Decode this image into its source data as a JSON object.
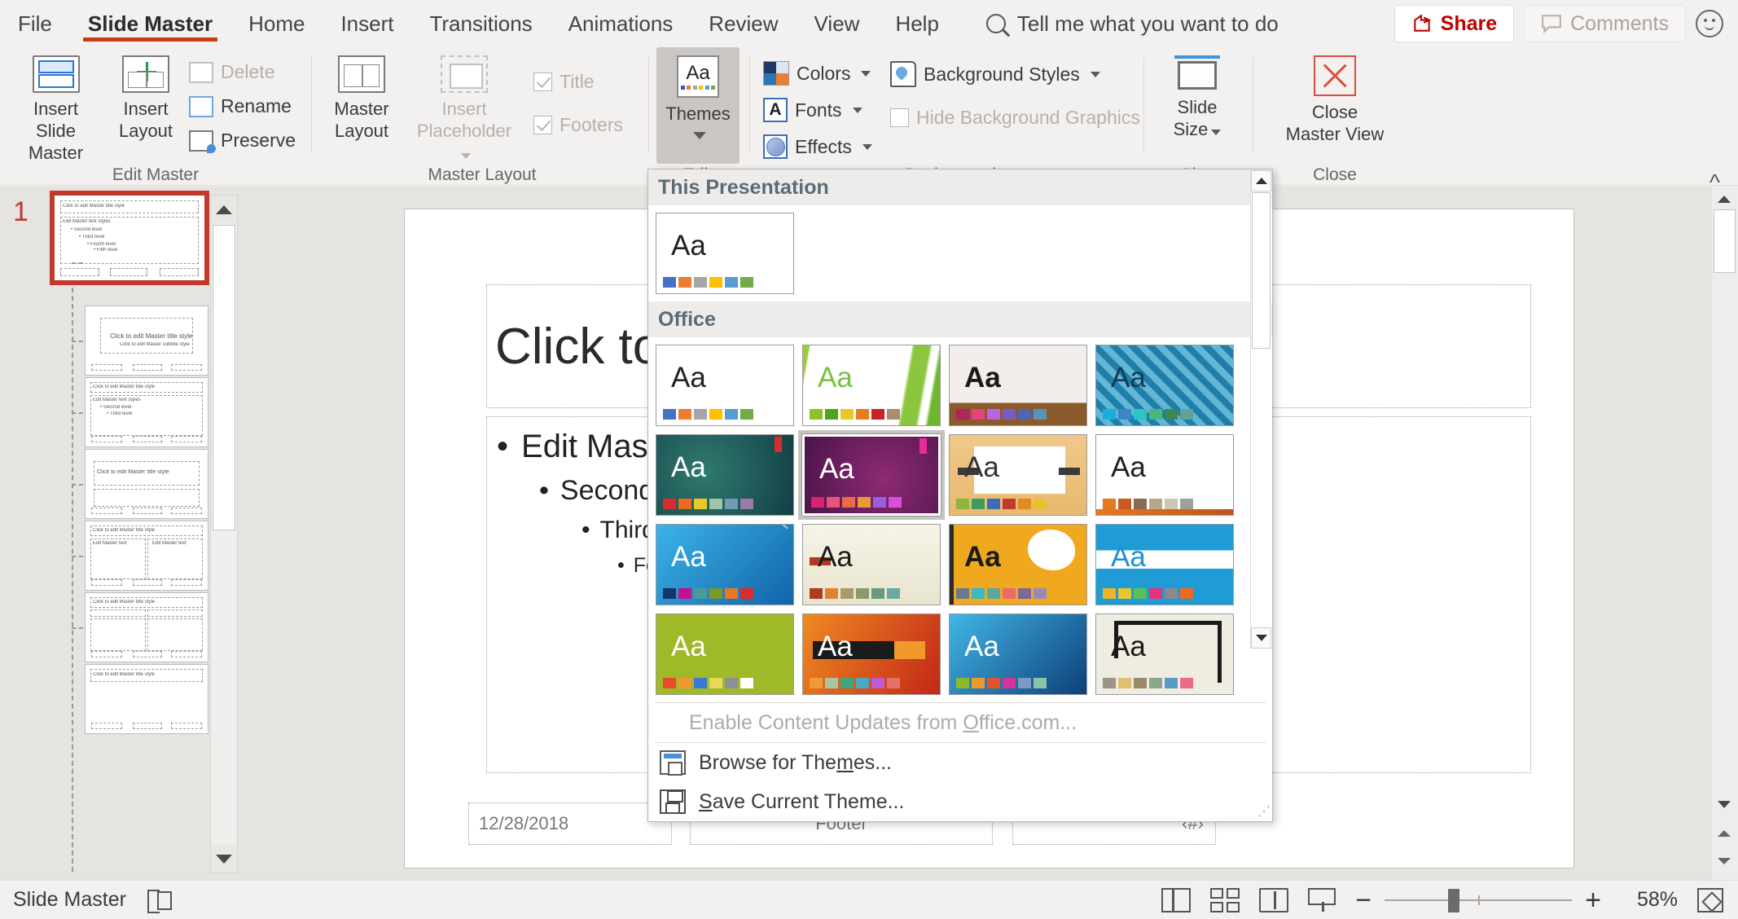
{
  "tabs": [
    {
      "label": "File",
      "active": false
    },
    {
      "label": "Slide Master",
      "active": true
    },
    {
      "label": "Home",
      "active": false
    },
    {
      "label": "Insert",
      "active": false
    },
    {
      "label": "Transitions",
      "active": false
    },
    {
      "label": "Animations",
      "active": false
    },
    {
      "label": "Review",
      "active": false
    },
    {
      "label": "View",
      "active": false
    },
    {
      "label": "Help",
      "active": false
    }
  ],
  "search": {
    "placeholder": "Tell me what you want to do",
    "icon": "search-icon"
  },
  "titlebar": {
    "share": "Share",
    "comments": "Comments",
    "smiley_icon": "smiley-face-icon"
  },
  "ribbon": {
    "groups": [
      {
        "label": "Edit Master"
      },
      {
        "label": "Master Layout"
      },
      {
        "label": "Edit Theme"
      },
      {
        "label": "Background"
      },
      {
        "label": "Size"
      },
      {
        "label": "Close"
      }
    ],
    "insert_slide_master": "Insert Slide\nMaster",
    "insert_slide_master_l1": "Insert Slide",
    "insert_slide_master_l2": "Master",
    "insert_layout_l1": "Insert",
    "insert_layout_l2": "Layout",
    "delete": "Delete",
    "rename": "Rename",
    "preserve": "Preserve",
    "master_layout_l1": "Master",
    "master_layout_l2": "Layout",
    "insert_placeholder_l1": "Insert",
    "insert_placeholder_l2": "Placeholder",
    "title_check": "Title",
    "footers_check": "Footers",
    "themes": "Themes",
    "colors": "Colors",
    "fonts": "Fonts",
    "effects": "Effects",
    "background_styles": "Background Styles",
    "hide_background_graphics": "Hide Background Graphics",
    "slide_size_l1": "Slide",
    "slide_size_l2": "Size",
    "close_master_l1": "Close",
    "close_master_l2": "Master View",
    "collapse_icon": "chevron-up-icon"
  },
  "slide_panel": {
    "slide_number": "1",
    "thumbs": [
      {
        "title": "Click to edit Master title style",
        "kind": "master"
      },
      {
        "title": "Click to edit Master title style",
        "kind": "title"
      },
      {
        "title": "Click to edit Master title style",
        "kind": "content"
      },
      {
        "title": "Click to edit Master title style",
        "kind": "section"
      },
      {
        "title": "Click to edit Master title style",
        "kind": "two-content"
      },
      {
        "title": "Click to edit Master title style",
        "kind": "comparison"
      },
      {
        "title": "Click to edit Master title style",
        "kind": "title-only"
      }
    ]
  },
  "slide": {
    "title_placeholder": "Click to edit Master title style",
    "bullets": [
      "Edit Master text styles",
      "Second level",
      "Third level",
      "Fourth level"
    ],
    "footer_date": "12/28/2018",
    "footer_text": "Footer",
    "footer_number": "‹#›"
  },
  "themes_dropdown": {
    "section_this_presentation": "This Presentation",
    "section_office": "Office",
    "enable_updates": "Enable Content Updates from Office.com...",
    "browse_for_themes": "Browse for Themes...",
    "save_current_theme": "Save Current Theme...",
    "scroll_up_icon": "triangle-up-icon",
    "scroll_down_icon": "triangle-down-icon",
    "aa_label": "Aa",
    "this_presentation_themes": [
      {
        "name": "office-theme",
        "aa_color": "#222222",
        "bg": "#ffffff",
        "swatches": [
          "#4472c4",
          "#ed7d31",
          "#a5a5a5",
          "#ffc000",
          "#5b9bd5",
          "#70ad47"
        ],
        "selected": false
      }
    ],
    "office_themes": [
      {
        "name": "office",
        "aa_color": "#222222",
        "bg": "#ffffff",
        "swatches": [
          "#4472c4",
          "#ed7d31",
          "#a5a5a5",
          "#ffc000",
          "#5b9bd5",
          "#70ad47"
        ],
        "selected": false
      },
      {
        "name": "facet",
        "aa_color": "#7ac143",
        "bg": "#ffffff",
        "swatches": [
          "#90c226",
          "#54a021",
          "#e8c72a",
          "#e87d1e",
          "#cb2128",
          "#a88d6a"
        ],
        "selected": false
      },
      {
        "name": "gallery",
        "aa_color": "#1a1a1a",
        "bg": "#efe9e6",
        "swatches": [
          "#b4245c",
          "#e8427f",
          "#b965e0",
          "#7a5bbf",
          "#4d66b5",
          "#5b93b8"
        ],
        "selected": false
      },
      {
        "name": "ion",
        "aa_color": "#103a52",
        "bg": "#1f7fa8",
        "swatches": [
          "#1caedb",
          "#3a86c8",
          "#2fc4c4",
          "#49b87a",
          "#3a8a4f",
          "#62a09a"
        ],
        "selected": false
      },
      {
        "name": "ion-boardroom",
        "aa_color": "#ffffff",
        "bg": "#215a5a",
        "swatches": [
          "#d92b2b",
          "#ea6a1f",
          "#e8c72a",
          "#9fc4a8",
          "#6f9bb5",
          "#9a7ba8"
        ],
        "selected": false
      },
      {
        "name": "badge",
        "aa_color": "#ffffff",
        "bg": "#6b2060",
        "swatches": [
          "#d6246e",
          "#e8537a",
          "#ea6a4a",
          "#eb9a36",
          "#9a5ce0",
          "#d94fd9"
        ],
        "selected": true
      },
      {
        "name": "berlin",
        "aa_color": "#333333",
        "bg": "#f0c88a",
        "swatches": [
          "#8cb63c",
          "#3c9e5e",
          "#3a6db5",
          "#c23a2b",
          "#e08a22",
          "#e8c22a"
        ],
        "selected": false
      },
      {
        "name": "celestial",
        "aa_color": "#222222",
        "bg": "#ffffff",
        "swatches": [
          "#e87722",
          "#c85a22",
          "#8a6a52",
          "#b5a88a",
          "#cdc6b0",
          "#9aa39a"
        ],
        "selected": false
      },
      {
        "name": "circuit",
        "aa_color": "#ffffff",
        "bg": "#1f9bd6",
        "swatches": [
          "#10366b",
          "#c2118a",
          "#4a9a9a",
          "#7a9a2a",
          "#e87722",
          "#d92b2b"
        ],
        "selected": false
      },
      {
        "name": "damask",
        "aa_color": "#1a1a1a",
        "bg": "#f2f1e4",
        "swatches": [
          "#b03a20",
          "#e08030",
          "#a89a6a",
          "#8a9a6a",
          "#6a9a7a",
          "#6aa8a0"
        ],
        "selected": false
      },
      {
        "name": "depth",
        "aa_color": "#1a1a1a",
        "bg": "#f0a81e",
        "swatches": [
          "#6a7a8a",
          "#3ab8c4",
          "#5aa8a0",
          "#e86a6a",
          "#7a6a9a",
          "#9a8ab5"
        ],
        "selected": false
      },
      {
        "name": "dividend",
        "aa_color": "#1f8fd6",
        "bg": "#1f9bd6",
        "swatches": [
          "#f0b323",
          "#e8c72a",
          "#5abf5a",
          "#e8327a",
          "#8a8a8a",
          "#ee6a1e"
        ],
        "selected": false
      },
      {
        "name": "droplet",
        "aa_color": "#ffffff",
        "bg": "#9fba28",
        "swatches": [
          "#e84a2a",
          "#ef9a2a",
          "#3a7ad6",
          "#e8d85a",
          "#8a8f9a",
          "#ffffff"
        ],
        "selected": false
      },
      {
        "name": "frame",
        "aa_color": "#ffffff",
        "bg": "#e05a20",
        "swatches": [
          "#ee9a3a",
          "#a8c6a0",
          "#3aa87a",
          "#4aa8c4",
          "#c25ad6",
          "#e8706a"
        ],
        "selected": false
      },
      {
        "name": "integral",
        "aa_color": "#ffffff",
        "bg": "#1f8fc4",
        "swatches": [
          "#8aba2a",
          "#ef9a2a",
          "#e8522a",
          "#d6329a",
          "#7a9ac4",
          "#8ac4a8"
        ],
        "selected": false
      },
      {
        "name": "ion-2",
        "aa_color": "#1a1a1a",
        "bg": "#efece2",
        "swatches": [
          "#9a948a",
          "#e0c070",
          "#9a8a6a",
          "#8aa88a",
          "#5a9ac4",
          "#ee6a8a"
        ],
        "selected": false
      }
    ]
  },
  "status": {
    "mode": "Slide Master",
    "accessibility_icon": "accessibility-checker-icon",
    "views": [
      {
        "name": "normal-view",
        "icon": "normal-view-icon"
      },
      {
        "name": "slide-sorter-view",
        "icon": "slide-sorter-icon"
      },
      {
        "name": "reading-view",
        "icon": "reading-view-icon"
      },
      {
        "name": "slide-show",
        "icon": "slide-show-icon"
      }
    ],
    "zoom_out": "−",
    "zoom_in": "+",
    "zoom_value": "58%",
    "fit_icon": "fit-to-window-icon"
  }
}
